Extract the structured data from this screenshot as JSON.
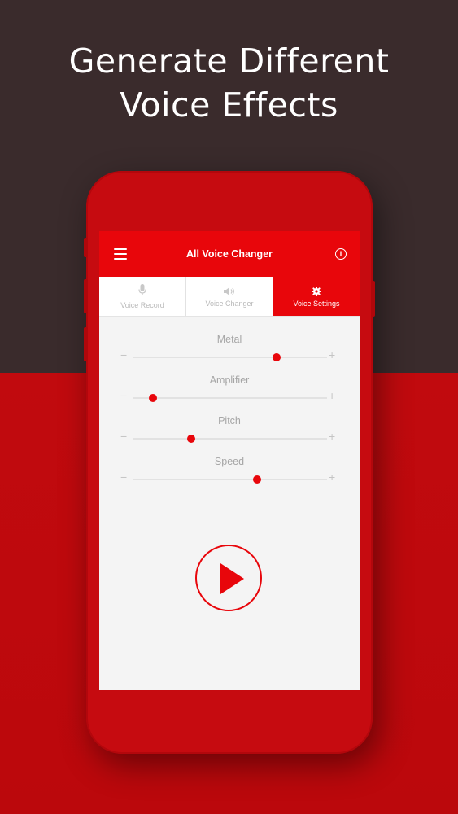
{
  "promo": {
    "headline": "Generate Different\nVoice Effects"
  },
  "app": {
    "title": "All Voice Changer",
    "accent_color": "#e8060b",
    "icons": {
      "menu": "hamburger-menu-icon",
      "info": "info-icon"
    }
  },
  "tabs": [
    {
      "label": "Voice Record",
      "icon": "microphone-icon",
      "active": false
    },
    {
      "label": "Voice Changer",
      "icon": "speaker-icon",
      "active": false
    },
    {
      "label": "Voice Settings",
      "icon": "gear-icon",
      "active": true
    }
  ],
  "sliders": [
    {
      "label": "Metal",
      "value": 0.74,
      "minus": "−",
      "plus": "+"
    },
    {
      "label": "Amplifier",
      "value": 0.1,
      "minus": "−",
      "plus": "+"
    },
    {
      "label": "Pitch",
      "value": 0.3,
      "minus": "−",
      "plus": "+"
    },
    {
      "label": "Speed",
      "value": 0.64,
      "minus": "−",
      "plus": "+"
    }
  ],
  "player": {
    "icon": "play-icon"
  }
}
